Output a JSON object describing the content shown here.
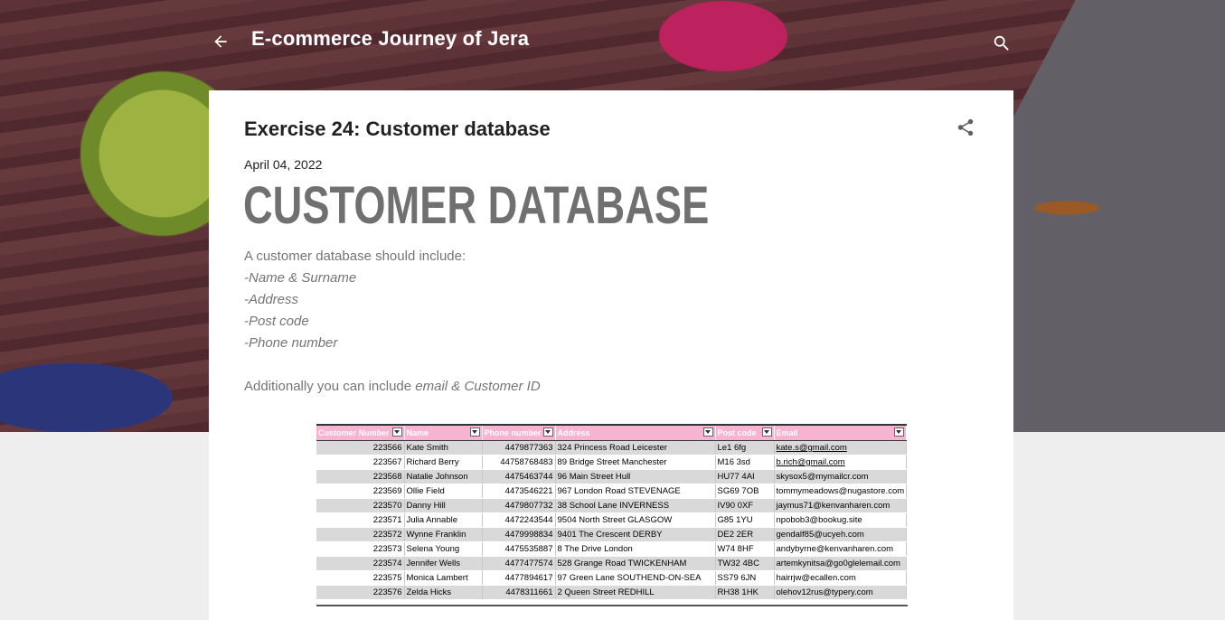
{
  "header": {
    "site_title": "E-commerce Journey of Jera"
  },
  "icons": {
    "back": "arrow-left-icon",
    "search": "search-icon",
    "share": "share-icon"
  },
  "post": {
    "title": "Exercise 24: Customer database",
    "date": "April 04, 2022",
    "heading": "CUSTOMER DATABASE",
    "intro": "A customer database should include:",
    "list": [
      "-Name & Surname",
      "-Address",
      "-Post code",
      "-Phone number"
    ],
    "additional_prefix": "Additionally you can include ",
    "additional_italic": "email & Customer ID"
  },
  "sheet": {
    "columns": [
      "Customer Number",
      "Name",
      "Phone number",
      "Address",
      "Post code",
      "Email"
    ],
    "rows": [
      [
        "223566",
        "Kate Smith",
        "4479877363",
        "324 Princess Road Leicester",
        "Le1 6fg",
        "kate.s@gmail.com"
      ],
      [
        "223567",
        "Richard Berry",
        "44758768483",
        "89 Bridge Street Manchester",
        "M16 3sd",
        "b.rich@gmail.com"
      ],
      [
        "223568",
        "Natalie Johnson",
        "4475463744",
        "96 Main Street Hull",
        "HU77 4AI",
        "skysox5@mymailcr.com"
      ],
      [
        "223569",
        "Ollie Field",
        "4473546221",
        "967 London Road STEVENAGE",
        "SG69 7OB",
        "tommymeadows@nugastore.com"
      ],
      [
        "223570",
        "Danny Hill",
        "4479807732",
        "38 School Lane INVERNESS",
        "IV90 0XF",
        "jaymus71@kenvanharen.com"
      ],
      [
        "223571",
        "Julia Annable",
        "4472243544",
        "9504 North Street GLASGOW",
        "G85 1YU",
        "npobob3@bookug.site"
      ],
      [
        "223572",
        "Wynne Franklin",
        "4479998834",
        "9401 The Crescent DERBY",
        "DE2 2ER",
        "gendalf85@ucyeh.com"
      ],
      [
        "223573",
        "Selena Young",
        "4475535887",
        "8 The Drive  London",
        "W74 8HF",
        "andybyrne@kenvanharen.com"
      ],
      [
        "223574",
        "Jennifer Wells",
        "4477477574",
        "528 Grange Road TWICKENHAM",
        "TW32 4BC",
        "artemkynitsa@go0glelemail.com"
      ],
      [
        "223575",
        "Monica Lambert",
        "4477894617",
        "97 Green Lane SOUTHEND-ON-SEA",
        "SS79 6JN",
        "hairrjw@ecallen.com"
      ],
      [
        "223576",
        "Zelda Hicks",
        "4478311661",
        "2 Queen Street REDHILL",
        "RH38 1HK",
        "olehov12rus@typery.com"
      ]
    ]
  }
}
